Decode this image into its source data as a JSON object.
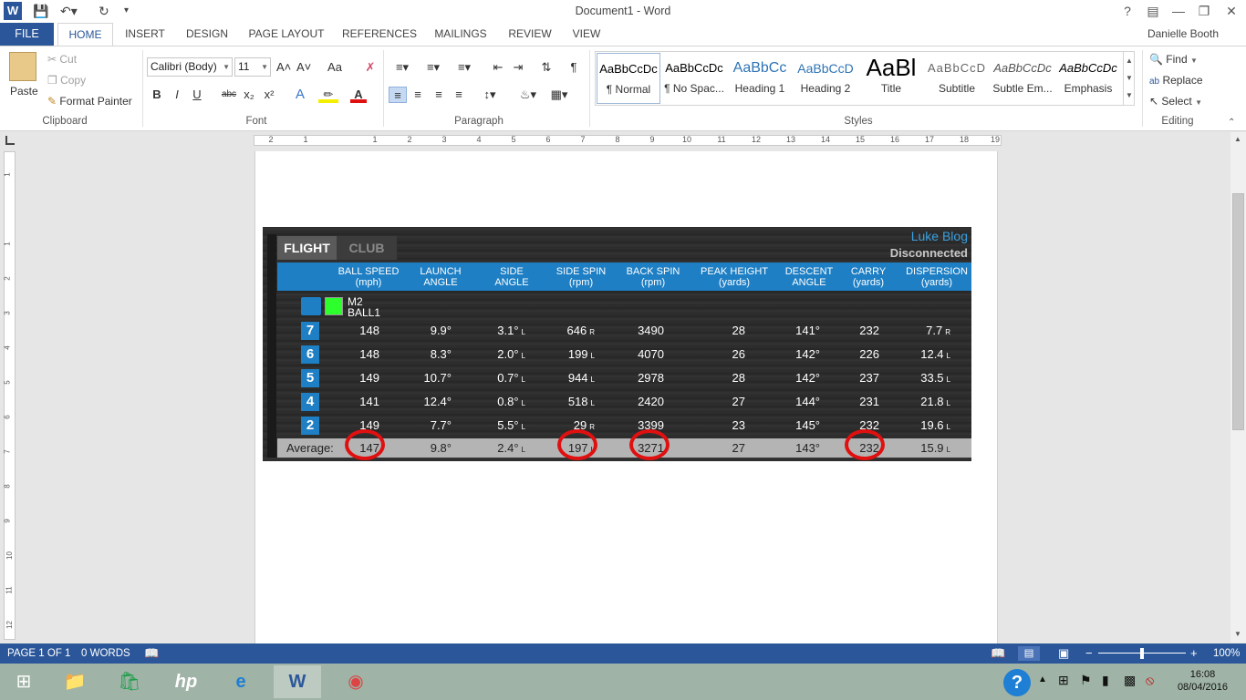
{
  "window": {
    "title": "Document1 - Word",
    "help": "?",
    "user": "Danielle Booth"
  },
  "tabs": {
    "file": "FILE",
    "home": "HOME",
    "insert": "INSERT",
    "design": "DESIGN",
    "page_layout": "PAGE LAYOUT",
    "references": "REFERENCES",
    "mailings": "MAILINGS",
    "review": "REVIEW",
    "view": "VIEW"
  },
  "clipboard": {
    "paste": "Paste",
    "cut": "Cut",
    "copy": "Copy",
    "format_painter": "Format Painter",
    "label": "Clipboard"
  },
  "font": {
    "name": "Calibri (Body)",
    "size": "11",
    "label": "Font",
    "bold": "B",
    "italic": "I",
    "underline": "U",
    "strike": "abc",
    "sub": "x₂",
    "sup": "x²",
    "grow": "A˄",
    "shrink": "A˅",
    "case": "Aa"
  },
  "paragraph": {
    "label": "Paragraph",
    "pilcrow": "¶"
  },
  "styles": {
    "label": "Styles",
    "items": [
      {
        "preview": "AaBbCcDc",
        "name": "¶ Normal"
      },
      {
        "preview": "AaBbCcDc",
        "name": "¶ No Spac..."
      },
      {
        "preview": "AaBbCc",
        "name": "Heading 1"
      },
      {
        "preview": "AaBbCcD",
        "name": "Heading 2"
      },
      {
        "preview": "AaBl",
        "name": "Title"
      },
      {
        "preview": "AaBbCcD",
        "name": "Subtitle"
      },
      {
        "preview": "AaBbCcDc",
        "name": "Subtle Em..."
      },
      {
        "preview": "AaBbCcDc",
        "name": "Emphasis"
      }
    ]
  },
  "editing": {
    "label": "Editing",
    "find": "Find",
    "replace": "Replace",
    "select": "Select"
  },
  "ruler": {
    "h_ticks": [
      "2",
      "1",
      "1",
      "2",
      "3",
      "4",
      "5",
      "6",
      "7",
      "8",
      "9",
      "10",
      "11",
      "12",
      "13",
      "14",
      "15",
      "16",
      "17",
      "18",
      "19"
    ],
    "v_ticks": [
      "1",
      "1",
      "2",
      "3",
      "4",
      "5",
      "6",
      "7",
      "8",
      "9",
      "10",
      "11",
      "12"
    ]
  },
  "golf": {
    "tab_flight": "FLIGHT",
    "tab_club": "CLUB",
    "brand": "Luke Blog",
    "status": "Disconnected",
    "headers": [
      [
        "BALL SPEED",
        "(mph)"
      ],
      [
        "LAUNCH",
        "ANGLE"
      ],
      [
        "SIDE",
        "ANGLE"
      ],
      [
        "SIDE SPIN",
        "(rpm)"
      ],
      [
        "BACK SPIN",
        "(rpm)"
      ],
      [
        "PEAK HEIGHT",
        "(yards)"
      ],
      [
        "DESCENT",
        "ANGLE"
      ],
      [
        "CARRY",
        "(yards)"
      ],
      [
        "DISPERSION",
        "(yards)"
      ]
    ],
    "club": {
      "line1": "M2",
      "line2": "BALL1"
    },
    "rows": [
      {
        "n": "7",
        "cells": [
          [
            "148",
            ""
          ],
          [
            "9.9°",
            ""
          ],
          [
            "3.1°",
            "L"
          ],
          [
            "646",
            "R"
          ],
          [
            "3490",
            ""
          ],
          [
            "28",
            ""
          ],
          [
            "141°",
            ""
          ],
          [
            "232",
            ""
          ],
          [
            "7.7",
            "R"
          ]
        ]
      },
      {
        "n": "6",
        "cells": [
          [
            "148",
            ""
          ],
          [
            "8.3°",
            ""
          ],
          [
            "2.0°",
            "L"
          ],
          [
            "199",
            "L"
          ],
          [
            "4070",
            ""
          ],
          [
            "26",
            ""
          ],
          [
            "142°",
            ""
          ],
          [
            "226",
            ""
          ],
          [
            "12.4",
            "L"
          ]
        ]
      },
      {
        "n": "5",
        "cells": [
          [
            "149",
            ""
          ],
          [
            "10.7°",
            ""
          ],
          [
            "0.7°",
            "L"
          ],
          [
            "944",
            "L"
          ],
          [
            "2978",
            ""
          ],
          [
            "28",
            ""
          ],
          [
            "142°",
            ""
          ],
          [
            "237",
            ""
          ],
          [
            "33.5",
            "L"
          ]
        ]
      },
      {
        "n": "4",
        "cells": [
          [
            "141",
            ""
          ],
          [
            "12.4°",
            ""
          ],
          [
            "0.8°",
            "L"
          ],
          [
            "518",
            "L"
          ],
          [
            "2420",
            ""
          ],
          [
            "27",
            ""
          ],
          [
            "144°",
            ""
          ],
          [
            "231",
            ""
          ],
          [
            "21.8",
            "L"
          ]
        ]
      },
      {
        "n": "2",
        "cells": [
          [
            "149",
            ""
          ],
          [
            "7.7°",
            ""
          ],
          [
            "5.5°",
            "L"
          ],
          [
            "29",
            "R"
          ],
          [
            "3399",
            ""
          ],
          [
            "23",
            ""
          ],
          [
            "145°",
            ""
          ],
          [
            "232",
            ""
          ],
          [
            "19.6",
            "L"
          ]
        ]
      }
    ],
    "average": {
      "label": "Average:",
      "cells": [
        [
          "147",
          ""
        ],
        [
          "9.8°",
          ""
        ],
        [
          "2.4°",
          "L"
        ],
        [
          "197",
          "L"
        ],
        [
          "3271",
          ""
        ],
        [
          "27",
          ""
        ],
        [
          "143°",
          ""
        ],
        [
          "232",
          ""
        ],
        [
          "15.9",
          "L"
        ]
      ],
      "circled": [
        0,
        3,
        4,
        7
      ]
    }
  },
  "status": {
    "page": "PAGE 1 OF 1",
    "words": "0 WORDS",
    "zoom": "100%"
  },
  "taskbar": {
    "time": "16:08",
    "date": "08/04/2016"
  },
  "colors": {
    "word_blue": "#2b579a",
    "golf_blue": "#1e7fc4",
    "ring_red": "#e01010"
  }
}
